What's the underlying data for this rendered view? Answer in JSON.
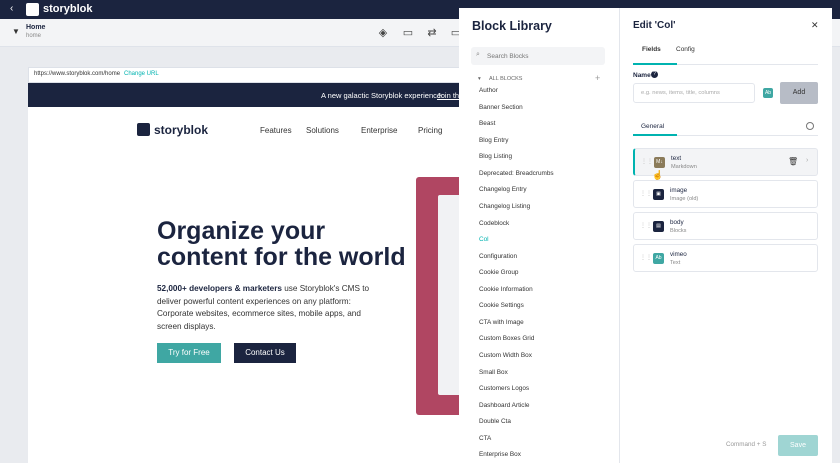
{
  "app": {
    "brand": "storyblok"
  },
  "page": {
    "title": "Home",
    "slug": "home"
  },
  "preview": {
    "url": "https://www.storyblok.com/home",
    "change_url": "Change URL",
    "banner_text": "A new galactic Storyblok experience:",
    "banner_link": "Join th",
    "site_brand": "storyblok",
    "nav": [
      "Features",
      "Solutions",
      "Enterprise",
      "Pricing"
    ],
    "hero_line1": "Organize your",
    "hero_line2": "content for the world",
    "para_bold": "52,000+ developers & marketers",
    "para_rest": " use Storyblok's CMS to deliver powerful content experiences on any platform: Corporate websites, ecommerce sites, mobile apps, and screen displays.",
    "btn_try": "Try for Free",
    "btn_contact": "Contact Us"
  },
  "block_library": {
    "title": "Block Library",
    "search_placeholder": "Search Blocks",
    "group": "ALL BLOCKS",
    "items": [
      "Author",
      "Banner Section",
      "Beast",
      "Blog Entry",
      "Blog Listing",
      "Deprecated: Breadcrumbs",
      "Changelog Entry",
      "Changelog Listing",
      "Codeblock",
      "Col",
      "Configuration",
      "Cookie Group",
      "Cookie Information",
      "Cookie Settings",
      "CTA with Image",
      "Custom Boxes Grid",
      "Custom Width Box",
      "Small Box",
      "Customers Logos",
      "Dashboard Article",
      "Double Cta",
      "CTA",
      "Enterprise Box"
    ],
    "active_item": "Col"
  },
  "edit": {
    "title": "Edit 'Col'",
    "tabs": [
      "Fields",
      "Config"
    ],
    "name_label": "Name",
    "name_placeholder": "e.g. news, items, title, columns",
    "add_label": "Add",
    "group_tab": "General",
    "fields": [
      {
        "name": "text",
        "kind": "Markdown",
        "badge": "M↓",
        "color": "#8b7b5a"
      },
      {
        "name": "image",
        "kind": "Image (old)",
        "badge": "▣",
        "color": "#1b243f"
      },
      {
        "name": "body",
        "kind": "Blocks",
        "badge": "▤",
        "color": "#1b243f"
      },
      {
        "name": "vimeo",
        "kind": "Text",
        "badge": "Ab",
        "color": "#3fa7a3"
      }
    ],
    "hotkey": "Command + S",
    "save_label": "Save"
  },
  "colors": {
    "accent": "#00b3b0",
    "navy": "#1b243f",
    "teal_button": "#3fa7a3"
  }
}
